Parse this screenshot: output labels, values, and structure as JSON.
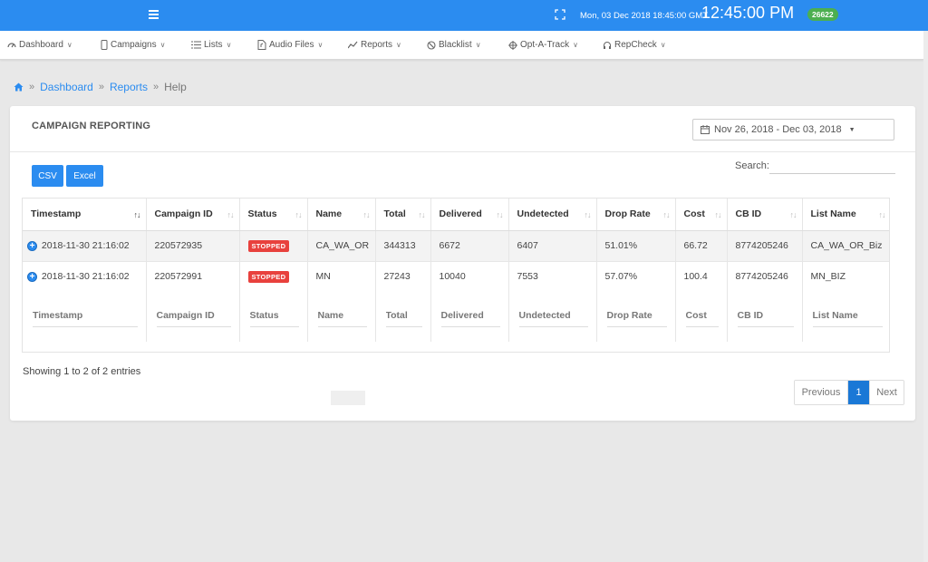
{
  "topbar": {
    "date_text": "Mon, 03 Dec 2018 18:45:00 GMT",
    "time_text": "12:45:00 PM",
    "badge": "26622"
  },
  "nav": {
    "items": [
      {
        "label": "Dashboard",
        "icon": "dashboard-icon"
      },
      {
        "label": "Campaigns",
        "icon": "mobile-icon"
      },
      {
        "label": "Lists",
        "icon": "list-icon"
      },
      {
        "label": "Audio Files",
        "icon": "audio-file-icon"
      },
      {
        "label": "Reports",
        "icon": "chart-line-icon"
      },
      {
        "label": "Blacklist",
        "icon": "ban-icon"
      },
      {
        "label": "Opt-A-Track",
        "icon": "crosshair-icon"
      },
      {
        "label": "RepCheck",
        "icon": "headset-icon"
      }
    ]
  },
  "breadcrumb": {
    "items": [
      "Dashboard",
      "Reports"
    ],
    "current": "Help",
    "separator": "»"
  },
  "panel": {
    "title": "CAMPAIGN REPORTING",
    "date_range": "Nov 26, 2018 - Dec 03, 2018",
    "csv_label": "CSV",
    "excel_label": "Excel",
    "search_label": "Search:",
    "search_value": ""
  },
  "table": {
    "columns": [
      "Timestamp",
      "Campaign ID",
      "Status",
      "Name",
      "Total",
      "Delivered",
      "Undetected",
      "Drop Rate",
      "Cost",
      "CB ID",
      "List Name"
    ],
    "rows": [
      {
        "timestamp": "2018-11-30 21:16:02",
        "campaign_id": "220572935",
        "status": "STOPPED",
        "name": "CA_WA_OR",
        "total": "344313",
        "delivered": "6672",
        "undetected": "6407",
        "drop_rate": "51.01%",
        "cost": "66.72",
        "cb_id": "8774205246",
        "list_name": "CA_WA_OR_Biz"
      },
      {
        "timestamp": "2018-11-30 21:16:02",
        "campaign_id": "220572991",
        "status": "STOPPED",
        "name": "MN",
        "total": "27243",
        "delivered": "10040",
        "undetected": "7553",
        "drop_rate": "57.07%",
        "cost": "100.4",
        "cb_id": "8774205246",
        "list_name": "MN_BIZ"
      }
    ],
    "filter_placeholders": [
      "Timestamp",
      "Campaign ID",
      "Status",
      "Name",
      "Total",
      "Delivered",
      "Undetected",
      "Drop Rate",
      "Cost",
      "CB ID",
      "List Name"
    ]
  },
  "footer": {
    "info": "Showing 1 to 2 of 2 entries",
    "prev_label": "Previous",
    "page": "1",
    "next_label": "Next"
  },
  "colors": {
    "accent": "#2b8cf0",
    "stopped": "#e8413d",
    "badge_green": "#4caf50"
  }
}
